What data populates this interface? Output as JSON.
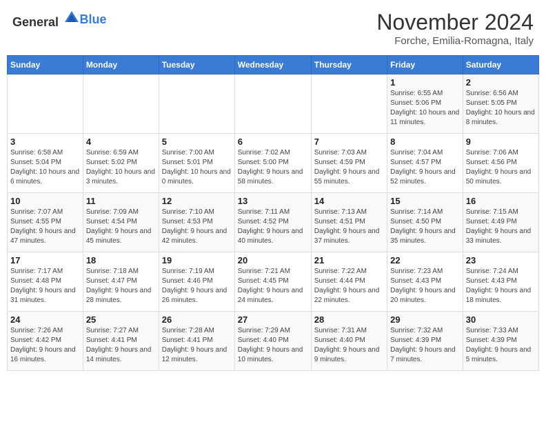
{
  "header": {
    "logo_general": "General",
    "logo_blue": "Blue",
    "month_title": "November 2024",
    "location": "Forche, Emilia-Romagna, Italy"
  },
  "days_of_week": [
    "Sunday",
    "Monday",
    "Tuesday",
    "Wednesday",
    "Thursday",
    "Friday",
    "Saturday"
  ],
  "weeks": [
    [
      {
        "day": "",
        "info": ""
      },
      {
        "day": "",
        "info": ""
      },
      {
        "day": "",
        "info": ""
      },
      {
        "day": "",
        "info": ""
      },
      {
        "day": "",
        "info": ""
      },
      {
        "day": "1",
        "info": "Sunrise: 6:55 AM\nSunset: 5:06 PM\nDaylight: 10 hours and 11 minutes."
      },
      {
        "day": "2",
        "info": "Sunrise: 6:56 AM\nSunset: 5:05 PM\nDaylight: 10 hours and 8 minutes."
      }
    ],
    [
      {
        "day": "3",
        "info": "Sunrise: 6:58 AM\nSunset: 5:04 PM\nDaylight: 10 hours and 6 minutes."
      },
      {
        "day": "4",
        "info": "Sunrise: 6:59 AM\nSunset: 5:02 PM\nDaylight: 10 hours and 3 minutes."
      },
      {
        "day": "5",
        "info": "Sunrise: 7:00 AM\nSunset: 5:01 PM\nDaylight: 10 hours and 0 minutes."
      },
      {
        "day": "6",
        "info": "Sunrise: 7:02 AM\nSunset: 5:00 PM\nDaylight: 9 hours and 58 minutes."
      },
      {
        "day": "7",
        "info": "Sunrise: 7:03 AM\nSunset: 4:59 PM\nDaylight: 9 hours and 55 minutes."
      },
      {
        "day": "8",
        "info": "Sunrise: 7:04 AM\nSunset: 4:57 PM\nDaylight: 9 hours and 52 minutes."
      },
      {
        "day": "9",
        "info": "Sunrise: 7:06 AM\nSunset: 4:56 PM\nDaylight: 9 hours and 50 minutes."
      }
    ],
    [
      {
        "day": "10",
        "info": "Sunrise: 7:07 AM\nSunset: 4:55 PM\nDaylight: 9 hours and 47 minutes."
      },
      {
        "day": "11",
        "info": "Sunrise: 7:09 AM\nSunset: 4:54 PM\nDaylight: 9 hours and 45 minutes."
      },
      {
        "day": "12",
        "info": "Sunrise: 7:10 AM\nSunset: 4:53 PM\nDaylight: 9 hours and 42 minutes."
      },
      {
        "day": "13",
        "info": "Sunrise: 7:11 AM\nSunset: 4:52 PM\nDaylight: 9 hours and 40 minutes."
      },
      {
        "day": "14",
        "info": "Sunrise: 7:13 AM\nSunset: 4:51 PM\nDaylight: 9 hours and 37 minutes."
      },
      {
        "day": "15",
        "info": "Sunrise: 7:14 AM\nSunset: 4:50 PM\nDaylight: 9 hours and 35 minutes."
      },
      {
        "day": "16",
        "info": "Sunrise: 7:15 AM\nSunset: 4:49 PM\nDaylight: 9 hours and 33 minutes."
      }
    ],
    [
      {
        "day": "17",
        "info": "Sunrise: 7:17 AM\nSunset: 4:48 PM\nDaylight: 9 hours and 31 minutes."
      },
      {
        "day": "18",
        "info": "Sunrise: 7:18 AM\nSunset: 4:47 PM\nDaylight: 9 hours and 28 minutes."
      },
      {
        "day": "19",
        "info": "Sunrise: 7:19 AM\nSunset: 4:46 PM\nDaylight: 9 hours and 26 minutes."
      },
      {
        "day": "20",
        "info": "Sunrise: 7:21 AM\nSunset: 4:45 PM\nDaylight: 9 hours and 24 minutes."
      },
      {
        "day": "21",
        "info": "Sunrise: 7:22 AM\nSunset: 4:44 PM\nDaylight: 9 hours and 22 minutes."
      },
      {
        "day": "22",
        "info": "Sunrise: 7:23 AM\nSunset: 4:43 PM\nDaylight: 9 hours and 20 minutes."
      },
      {
        "day": "23",
        "info": "Sunrise: 7:24 AM\nSunset: 4:43 PM\nDaylight: 9 hours and 18 minutes."
      }
    ],
    [
      {
        "day": "24",
        "info": "Sunrise: 7:26 AM\nSunset: 4:42 PM\nDaylight: 9 hours and 16 minutes."
      },
      {
        "day": "25",
        "info": "Sunrise: 7:27 AM\nSunset: 4:41 PM\nDaylight: 9 hours and 14 minutes."
      },
      {
        "day": "26",
        "info": "Sunrise: 7:28 AM\nSunset: 4:41 PM\nDaylight: 9 hours and 12 minutes."
      },
      {
        "day": "27",
        "info": "Sunrise: 7:29 AM\nSunset: 4:40 PM\nDaylight: 9 hours and 10 minutes."
      },
      {
        "day": "28",
        "info": "Sunrise: 7:31 AM\nSunset: 4:40 PM\nDaylight: 9 hours and 9 minutes."
      },
      {
        "day": "29",
        "info": "Sunrise: 7:32 AM\nSunset: 4:39 PM\nDaylight: 9 hours and 7 minutes."
      },
      {
        "day": "30",
        "info": "Sunrise: 7:33 AM\nSunset: 4:39 PM\nDaylight: 9 hours and 5 minutes."
      }
    ]
  ]
}
